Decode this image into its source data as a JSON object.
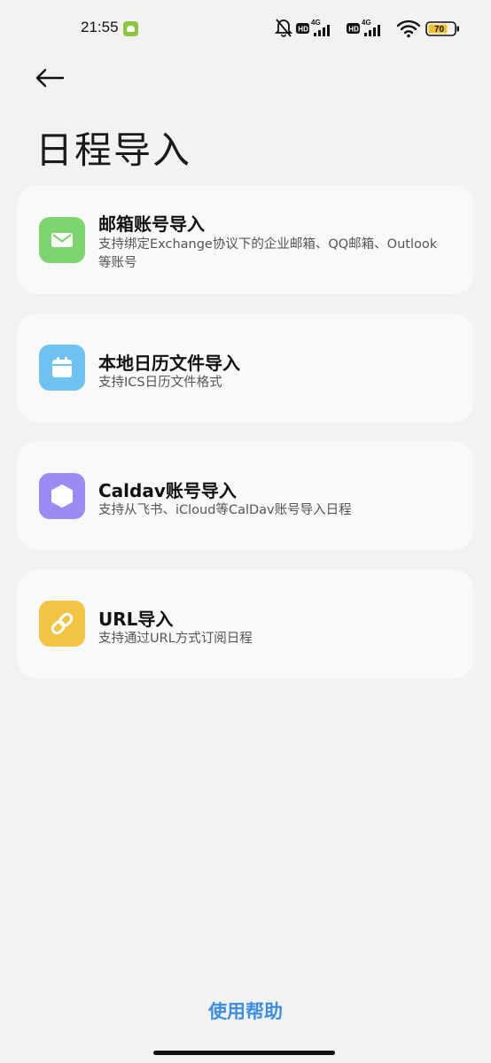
{
  "status_bar": {
    "time": "21:55",
    "battery": "70",
    "network_label_1": "4G",
    "network_label_2": "4G",
    "hd_label": "HD"
  },
  "header": {
    "title": "日程导入"
  },
  "cards": [
    {
      "title": "邮箱账号导入",
      "description": "支持绑定Exchange协议下的企业邮箱、QQ邮箱、Outlook等账号",
      "icon": "mail-icon",
      "color": "#7ed56f"
    },
    {
      "title": "本地日历文件导入",
      "description": "支持ICS日历文件格式",
      "icon": "calendar-icon",
      "color": "#6fc3f2"
    },
    {
      "title": "Caldav账号导入",
      "description": "支持从飞书、iCloud等CalDav账号导入日程",
      "icon": "hexagon-icon",
      "color": "#9a8cf2"
    },
    {
      "title": "URL导入",
      "description": "支持通过URL方式订阅日程",
      "icon": "link-icon",
      "color": "#f3c344"
    }
  ],
  "footer": {
    "help_label": "使用帮助"
  }
}
